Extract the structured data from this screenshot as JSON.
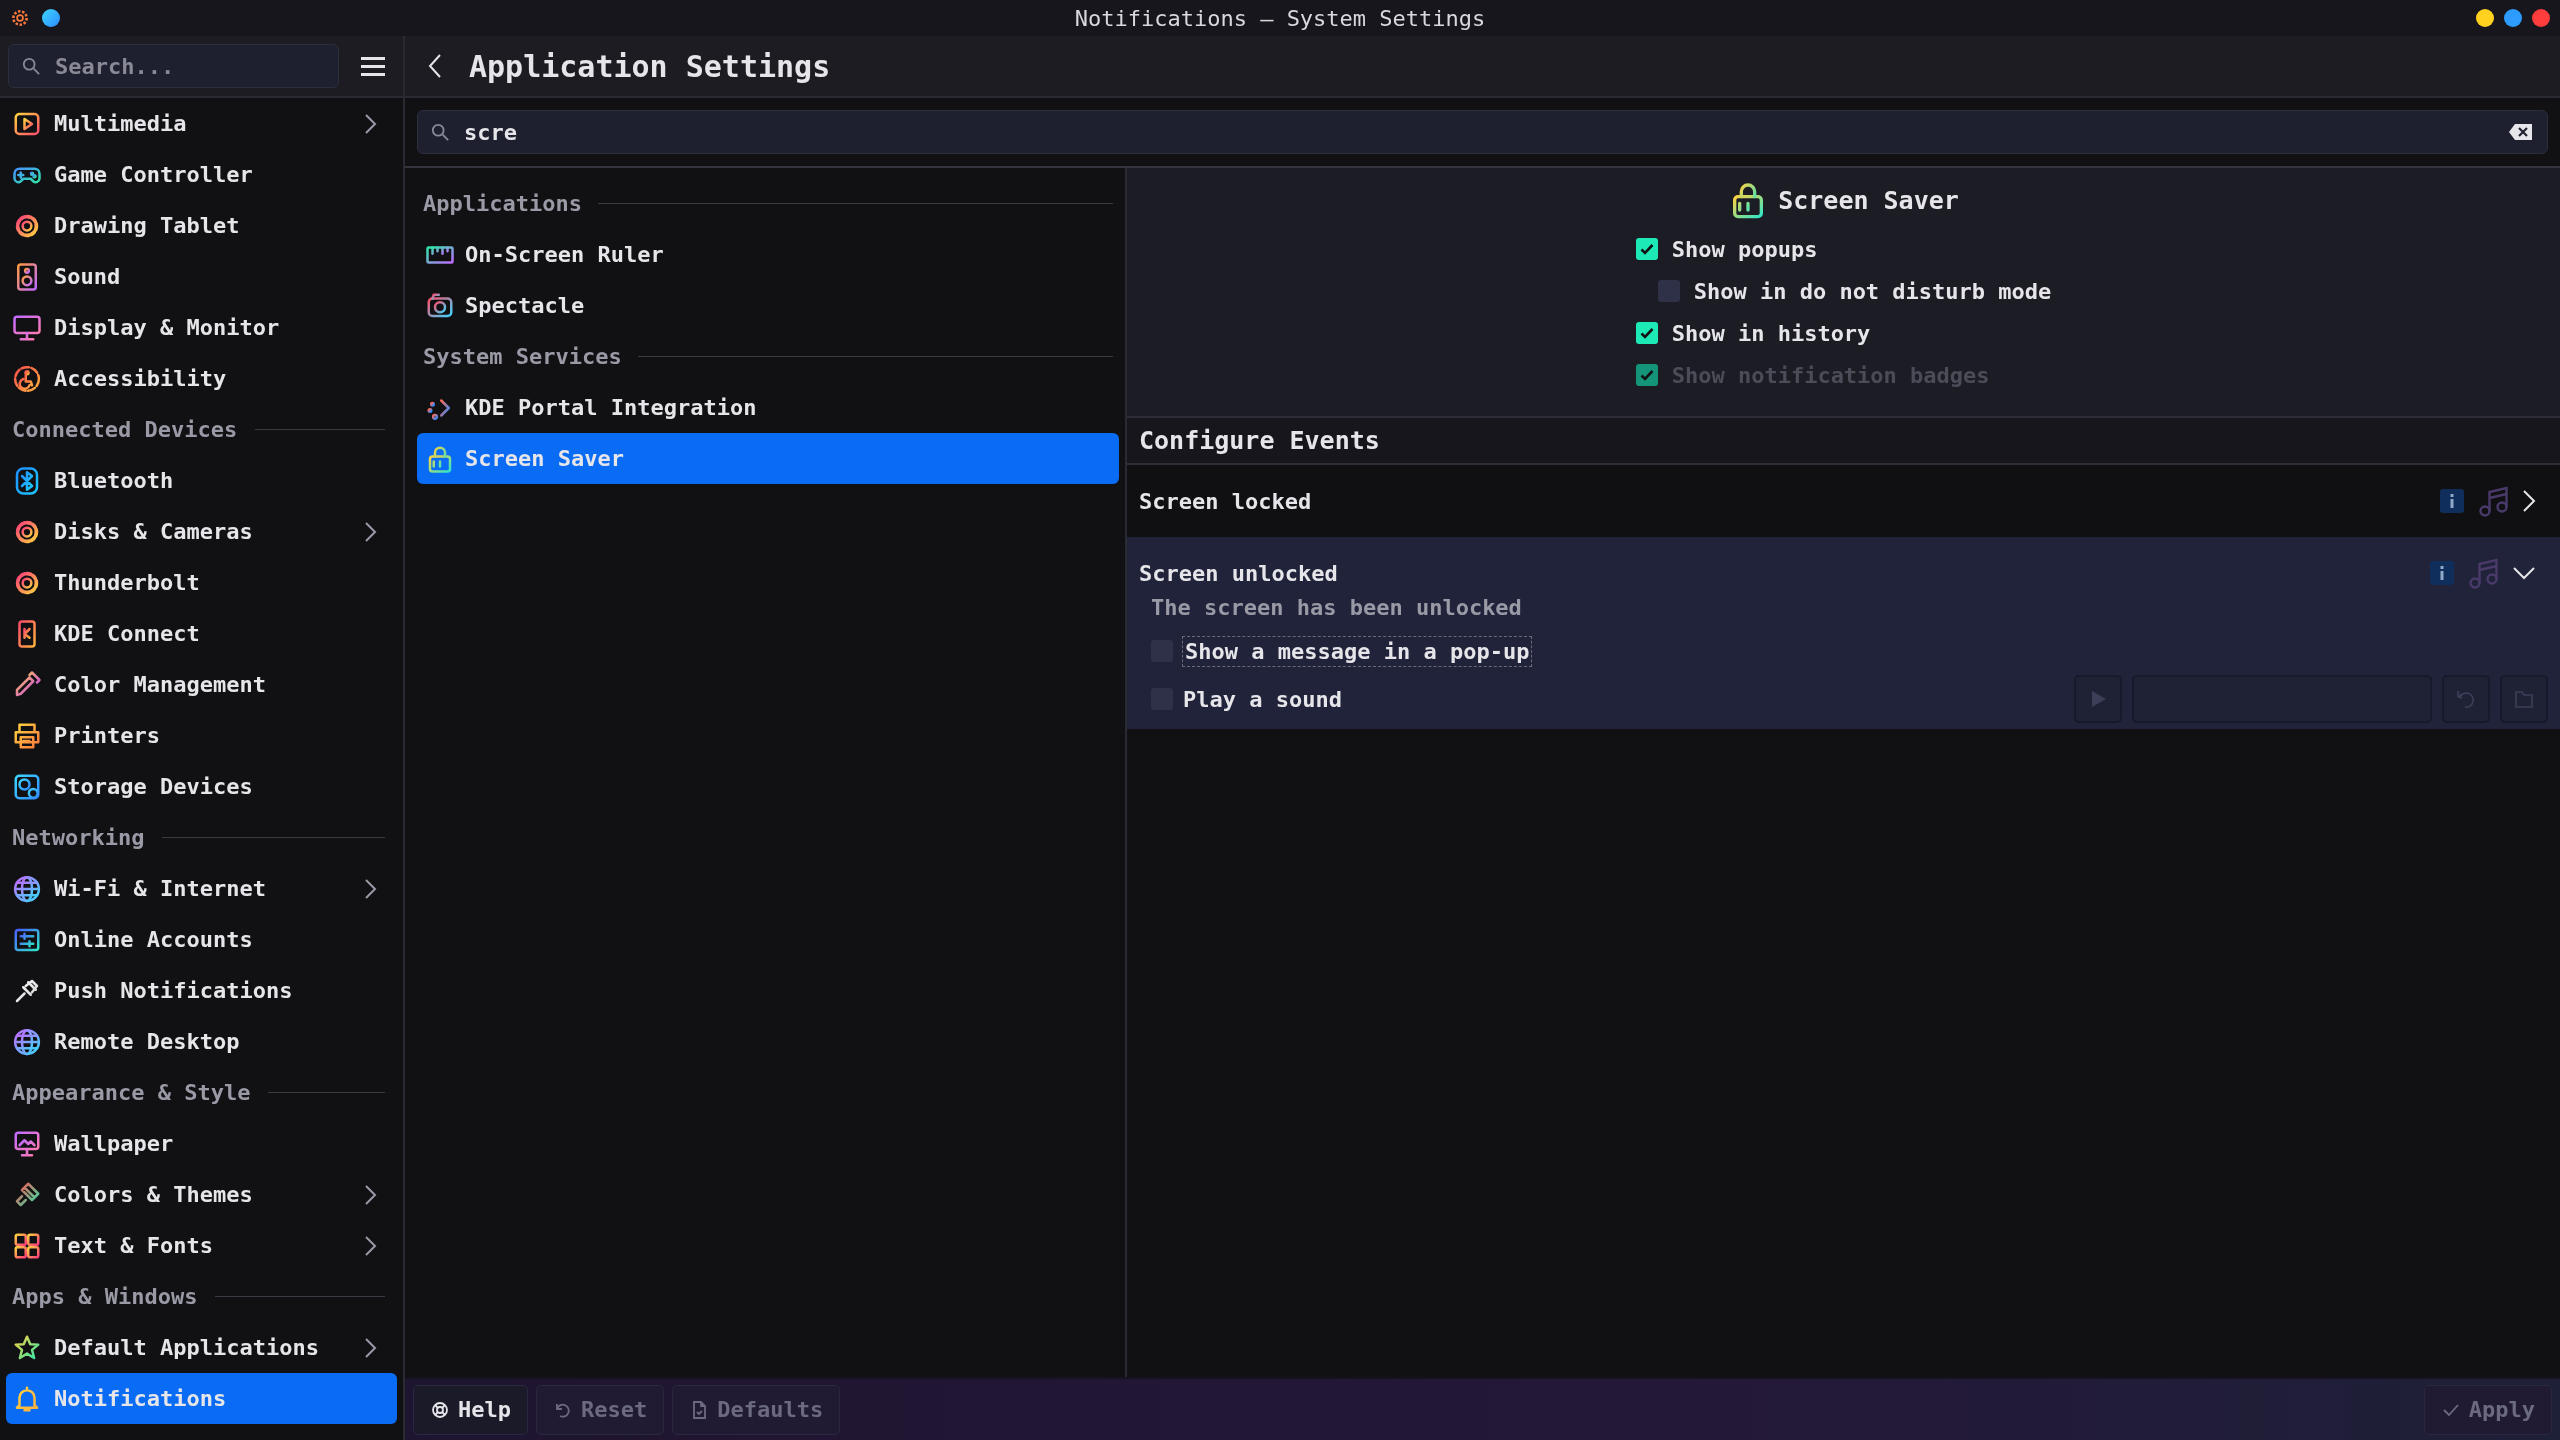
{
  "window": {
    "title": "Notifications — System Settings"
  },
  "sidebar": {
    "search": {
      "placeholder": "Search..."
    },
    "groups": [
      {
        "items": [
          {
            "label": "Multimedia",
            "has_children": true,
            "selected": false
          },
          {
            "label": "Game Controller",
            "has_children": false,
            "selected": false
          },
          {
            "label": "Drawing Tablet",
            "has_children": false,
            "selected": false
          },
          {
            "label": "Sound",
            "has_children": false,
            "selected": false
          },
          {
            "label": "Display & Monitor",
            "has_children": false,
            "selected": false
          },
          {
            "label": "Accessibility",
            "has_children": false,
            "selected": false
          }
        ]
      },
      {
        "heading": "Connected Devices",
        "items": [
          {
            "label": "Bluetooth",
            "has_children": false,
            "selected": false
          },
          {
            "label": "Disks & Cameras",
            "has_children": true,
            "selected": false
          },
          {
            "label": "Thunderbolt",
            "has_children": false,
            "selected": false
          },
          {
            "label": "KDE Connect",
            "has_children": false,
            "selected": false
          },
          {
            "label": "Color Management",
            "has_children": false,
            "selected": false
          },
          {
            "label": "Printers",
            "has_children": false,
            "selected": false
          },
          {
            "label": "Storage Devices",
            "has_children": false,
            "selected": false
          }
        ]
      },
      {
        "heading": "Networking",
        "items": [
          {
            "label": "Wi-Fi & Internet",
            "has_children": true,
            "selected": false
          },
          {
            "label": "Online Accounts",
            "has_children": false,
            "selected": false
          },
          {
            "label": "Push Notifications",
            "has_children": false,
            "selected": false
          },
          {
            "label": "Remote Desktop",
            "has_children": false,
            "selected": false
          }
        ]
      },
      {
        "heading": "Appearance & Style",
        "items": [
          {
            "label": "Wallpaper",
            "has_children": false,
            "selected": false
          },
          {
            "label": "Colors & Themes",
            "has_children": true,
            "selected": false
          },
          {
            "label": "Text & Fonts",
            "has_children": true,
            "selected": false
          }
        ]
      },
      {
        "heading": "Apps & Windows",
        "items": [
          {
            "label": "Default Applications",
            "has_children": true,
            "selected": false
          },
          {
            "label": "Notifications",
            "has_children": false,
            "selected": true
          }
        ]
      }
    ]
  },
  "page": {
    "title": "Application Settings"
  },
  "app_search": {
    "value": "scre"
  },
  "app_list": {
    "groups": [
      {
        "heading": "Applications",
        "items": [
          {
            "label": "On-Screen Ruler",
            "selected": false
          },
          {
            "label": "Spectacle",
            "selected": false
          }
        ]
      },
      {
        "heading": "System Services",
        "items": [
          {
            "label": "KDE Portal Integration",
            "selected": false
          },
          {
            "label": "Screen Saver",
            "selected": true
          }
        ]
      }
    ]
  },
  "details": {
    "title": "Screen Saver",
    "options": [
      {
        "label": "Show popups",
        "checked": true,
        "disabled": false,
        "children": [
          {
            "label": "Show in do not disturb mode",
            "checked": false,
            "disabled": false
          }
        ]
      },
      {
        "label": "Show in history",
        "checked": true,
        "disabled": false
      },
      {
        "label": "Show notification badges",
        "checked": true,
        "disabled": true
      }
    ]
  },
  "events": {
    "heading": "Configure Events",
    "items": [
      {
        "label": "Screen locked",
        "expanded": false
      },
      {
        "label": "Screen unlocked",
        "expanded": true,
        "description": "The screen has been unlocked",
        "options": [
          {
            "kind": "popup",
            "label": "Show a message in a pop-up",
            "checked": false,
            "focused": true
          },
          {
            "kind": "sound",
            "label": "Play a sound",
            "checked": false,
            "focused": false
          }
        ]
      }
    ]
  },
  "footer": {
    "buttons": [
      {
        "kind": "help",
        "label": "Help",
        "disabled": false
      },
      {
        "kind": "reset",
        "label": "Reset",
        "disabled": true
      },
      {
        "kind": "defaults",
        "label": "Defaults",
        "disabled": true
      },
      {
        "kind": "apply",
        "label": "Apply",
        "disabled": true
      }
    ]
  }
}
